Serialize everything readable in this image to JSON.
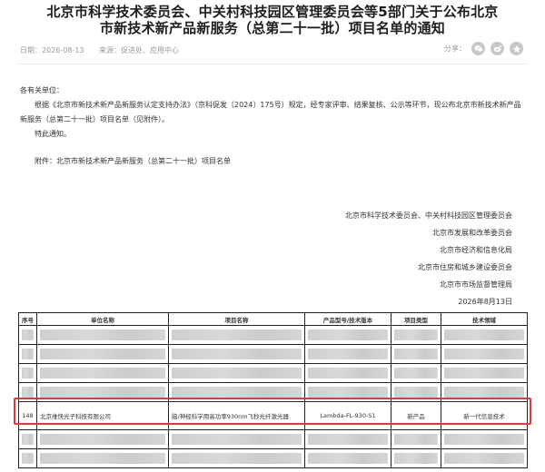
{
  "title": {
    "line1": "北京市科学技术委员会、中关村科技园区管理委员会等5部门关于公布北京",
    "line2": "市新技术新产品新服务（总第二十一批）项目名单的通知"
  },
  "meta": {
    "date": "日期：2026-08-13",
    "source": "来源：促进处、应用中心"
  },
  "share": {
    "label": "分享：",
    "icons": [
      "wechat-icon",
      "weibo-icon",
      "qzone-icon"
    ]
  },
  "body": {
    "salutation": "各有关单位：",
    "para1": "根据《北京市新技术新产品新服务认定支持办法》（京科促发〔2024〕175号）规定，经专家评审、结果复核、公示等环节，现公布北京市新技术新产品新服务（总第二十一批）项目名单（见附件）。",
    "para2": "特此通知。",
    "attachment": "附件：北京市新技术新产品新服务（总第二十一批）项目名单"
  },
  "signature": {
    "org1": "北京市科学技术委员会、中关村科技园区管理委员会",
    "org2": "北京市发展和改革委员会",
    "org3": "北京市经济和信息化局",
    "org4": "北京市住房和城乡建设委员会",
    "org5": "北京市市场监督管理局",
    "date": "2026年8月13日"
  },
  "table": {
    "headers": [
      "序号",
      "单位名称",
      "项目名称",
      "产品型号/技术版本",
      "项目类型",
      "技术领域"
    ],
    "highlight_row": {
      "index": "148",
      "company": "北京维快光子科技有限公司",
      "project": "脑/神经科学用高功率930nm飞秒光纤激光器",
      "model": "Lambda-FL-930-S1",
      "type": "新产品",
      "field": "新一代信息技术"
    }
  },
  "colors": {
    "highlight_border": "#e23a3a",
    "title": "#1d1d1d",
    "meta": "#9a9a9a"
  }
}
